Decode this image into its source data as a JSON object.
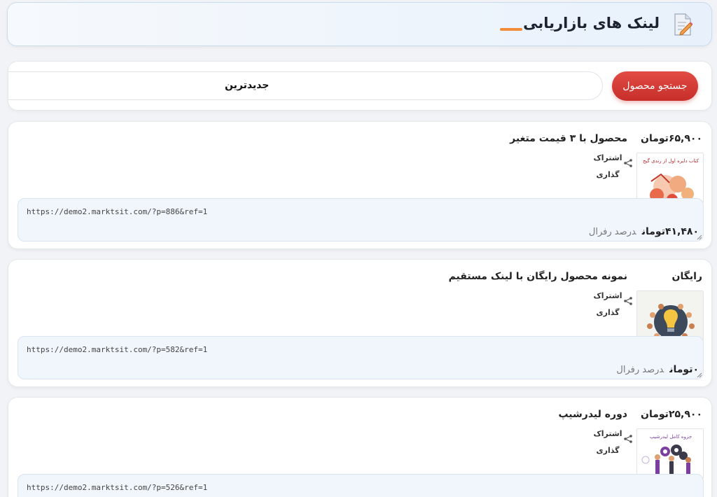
{
  "header": {
    "title": "لینک های بازاریابی",
    "icon": "edit-document-icon",
    "accent_color": "#f28c3a"
  },
  "search": {
    "button_label": "جستجو محصول",
    "sort_value": "جدیدترین",
    "button_color": "#d43a35"
  },
  "products": [
    {
      "price": "۶۵,۹۰۰تومان",
      "title": "محصول با ۳ قیمت متغیر",
      "share_label": "اشتراک گذاری",
      "thumb_caption": "کتاب دایره اول از رندی گیج",
      "link": "https://demo2.marktsit.com/?p=886&ref=1",
      "commission_value": "۴۱,۴۸۰تومان",
      "commission_label": "درصد رفرال"
    },
    {
      "price": "رایگان",
      "title": "نمونه محصول رایگان با لینک مستقیم",
      "share_label": "اشتراک گذاری",
      "thumb_caption": "",
      "link": "https://demo2.marktsit.com/?p=582&ref=1",
      "commission_value": "۰تومان",
      "commission_label": "درصد رفرال"
    },
    {
      "price": "۲۵,۹۰۰تومان",
      "title": "دوره لیدرشیپ",
      "share_label": "اشتراک گذاری",
      "thumb_caption": "جزوه کامل لیدرشیپ",
      "link": "https://demo2.marktsit.com/?p=526&ref=1",
      "commission_value": "",
      "commission_label": ""
    }
  ]
}
